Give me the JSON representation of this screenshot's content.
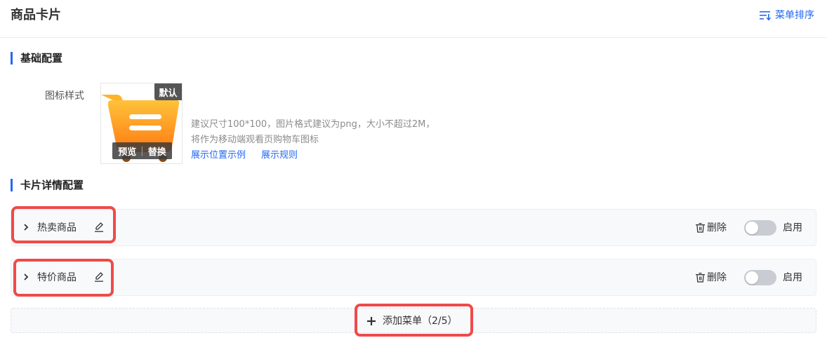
{
  "header": {
    "title": "商品卡片",
    "sort_label": "菜单排序",
    "sort_icon": "sort-lines-icon"
  },
  "basic_config": {
    "title": "基础配置",
    "icon_style_label": "图标样式",
    "default_badge": "默认",
    "preview_label": "预览",
    "separator": "|",
    "replace_label": "替换",
    "hint_line1": "建议尺寸100*100，图片格式建议为png，大小不超过2M，",
    "hint_line2": "将作为移动端观看页购物车图标",
    "link_position": "展示位置示例",
    "link_rules": "展示规则",
    "icon": "shopping-cart-icon"
  },
  "card_config": {
    "title": "卡片详情配置",
    "rows": [
      {
        "name": "热卖商品",
        "delete_label": "删除",
        "enable_label": "启用",
        "enabled": false
      },
      {
        "name": "特价商品",
        "delete_label": "删除",
        "enable_label": "启用",
        "enabled": false
      }
    ],
    "add_label": "添加菜单（2/5）"
  },
  "colors": {
    "accent": "#2468f2",
    "highlight": "#f04a4a",
    "toggle_off": "#c9ccd3",
    "cart_orange": "#ff9a1f"
  }
}
